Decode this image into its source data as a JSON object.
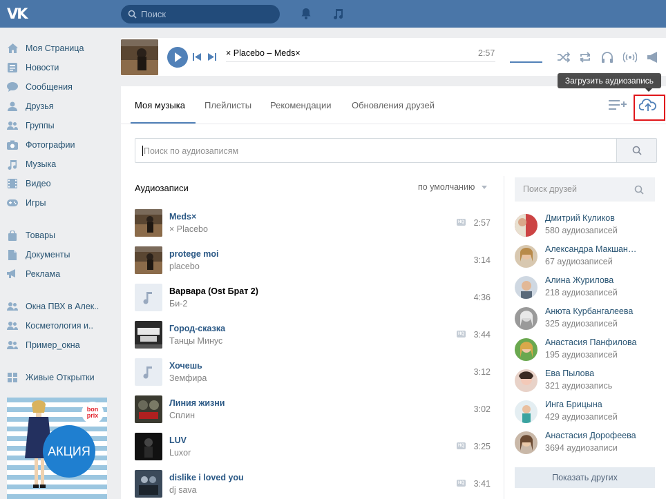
{
  "header": {
    "logo_text": "VK",
    "search_placeholder": "Поиск",
    "accent": "#4a76a8"
  },
  "sidebar": {
    "items": [
      {
        "label": "Моя Страница",
        "icon": "home-icon"
      },
      {
        "label": "Новости",
        "icon": "news-icon"
      },
      {
        "label": "Сообщения",
        "icon": "messages-icon"
      },
      {
        "label": "Друзья",
        "icon": "friends-icon"
      },
      {
        "label": "Группы",
        "icon": "groups-icon"
      },
      {
        "label": "Фотографии",
        "icon": "camera-icon"
      },
      {
        "label": "Музыка",
        "icon": "music-note-icon"
      },
      {
        "label": "Видео",
        "icon": "video-icon"
      },
      {
        "label": "Игры",
        "icon": "gamepad-icon"
      },
      {
        "label": "Товары",
        "icon": "shopping-bag-icon"
      },
      {
        "label": "Документы",
        "icon": "document-icon"
      },
      {
        "label": "Реклама",
        "icon": "megaphone-icon"
      },
      {
        "label": "Окна ПВХ в Алек..",
        "icon": "group-icon"
      },
      {
        "label": "Косметология и..",
        "icon": "group-icon"
      },
      {
        "label": "Пример_окна",
        "icon": "group-icon"
      },
      {
        "label": "Живые Открытки",
        "icon": "apps-grid-icon"
      }
    ],
    "ad": {
      "brand": "bon prix",
      "text": "АКЦИЯ"
    }
  },
  "player": {
    "track": "× Placebo – Meds×",
    "time": "2:57"
  },
  "tabs": [
    {
      "label": "Моя музыка",
      "active": true
    },
    {
      "label": "Плейлисты",
      "active": false
    },
    {
      "label": "Рекомендации",
      "active": false
    },
    {
      "label": "Обновления друзей",
      "active": false
    }
  ],
  "tooltip": "Загрузить аудиозапись",
  "audio_search_placeholder": "Поиск по аудиозаписям",
  "list": {
    "title": "Аудиозаписи",
    "sort": "по умолчанию",
    "hq_label": "HQ",
    "tracks": [
      {
        "title": "Meds×",
        "artist": "× Placebo",
        "duration": "2:57",
        "hq": true
      },
      {
        "title": "protege moi",
        "artist": "placebo",
        "duration": "3:14",
        "hq": false
      },
      {
        "title": "Варвара (Ost Брат 2)",
        "artist": "Би-2",
        "duration": "4:36",
        "hq": false
      },
      {
        "title": "Город-сказка",
        "artist": "Танцы Минус",
        "duration": "3:44",
        "hq": true
      },
      {
        "title": "Хочешь",
        "artist": "Земфира",
        "duration": "3:12",
        "hq": false
      },
      {
        "title": "Линия жизни",
        "artist": "Сплин",
        "duration": "3:02",
        "hq": false
      },
      {
        "title": "LUV",
        "artist": "Luxor",
        "duration": "3:25",
        "hq": true
      },
      {
        "title": "dislike i loved you",
        "artist": "dj sava",
        "duration": "3:41",
        "hq": true
      }
    ]
  },
  "friends": {
    "search_placeholder": "Поиск друзей",
    "items": [
      {
        "name": "Дмитрий Куликов",
        "count": "580 аудиозаписей"
      },
      {
        "name": "Александра Макшан…",
        "count": "67 аудиозаписей"
      },
      {
        "name": "Алина Журилова",
        "count": "218 аудиозаписей"
      },
      {
        "name": "Анюта Курбангалеева",
        "count": "325 аудиозаписей"
      },
      {
        "name": "Анастасия Панфилова",
        "count": "195 аудиозаписей"
      },
      {
        "name": "Ева Пылова",
        "count": "321 аудиозапись"
      },
      {
        "name": "Инга Брицына",
        "count": "429 аудиозаписей"
      },
      {
        "name": "Анастасия Дорофеева",
        "count": "3694 аудиозаписи"
      }
    ],
    "show_more": "Показать других"
  }
}
